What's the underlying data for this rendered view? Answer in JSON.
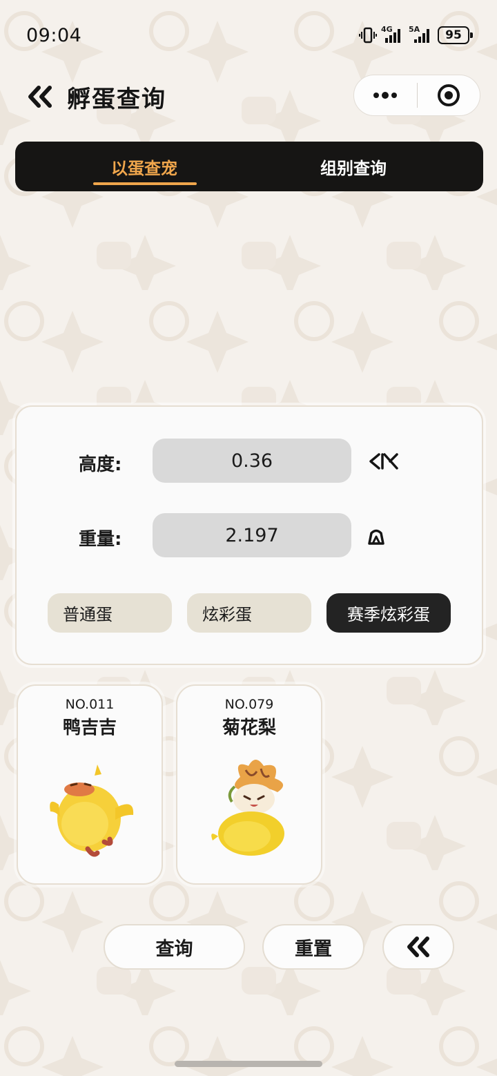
{
  "status_bar": {
    "time": "09:04",
    "network_1": "4G",
    "network_2": "5A",
    "battery": "95",
    "icons": [
      "vibrate-icon",
      "signal-icon",
      "signal-icon",
      "battery-icon"
    ]
  },
  "header": {
    "title": "孵蛋查询",
    "back_icon": "double-chevron-left-icon",
    "menu_icon": "more-dots-icon",
    "close_icon": "target-circle-icon"
  },
  "tabs": [
    {
      "label": "以蛋查宠",
      "active": true
    },
    {
      "label": "组别查询",
      "active": false
    }
  ],
  "form": {
    "height": {
      "label": "高度:",
      "value": "0.36",
      "unit_icon": "height-ruler-icon"
    },
    "weight": {
      "label": "重量:",
      "value": "2.197",
      "unit_icon": "weight-icon"
    },
    "egg_types": [
      {
        "label": "普通蛋",
        "selected": false
      },
      {
        "label": "炫彩蛋",
        "selected": false
      },
      {
        "label": "赛季炫彩蛋",
        "selected": true
      }
    ]
  },
  "results": [
    {
      "no": "NO.011",
      "name": "鸭吉吉",
      "image_icon": "yellow-duck-pet-icon"
    },
    {
      "no": "NO.079",
      "name": "菊花梨",
      "image_icon": "flower-pear-pet-icon"
    }
  ],
  "actions": {
    "query": "查询",
    "reset": "重置",
    "collapse_icon": "double-chevron-left-icon"
  },
  "colors": {
    "background": "#f5f1ec",
    "tab_active": "#f0a64c",
    "tab_bar": "#161514",
    "input_bg": "#d9d9d9",
    "chip_bg": "#e6e1d4",
    "chip_active": "#232323"
  }
}
